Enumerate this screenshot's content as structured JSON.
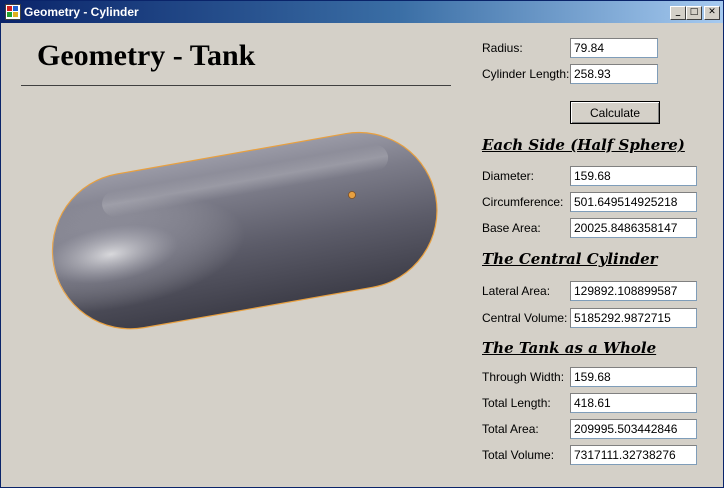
{
  "window": {
    "title": "Geometry - Cylinder",
    "minimize_label": "_",
    "maximize_label": "□",
    "close_label": "✕"
  },
  "heading": "Geometry - Tank",
  "inputs": {
    "radius_label": "Radius:",
    "radius_value": "79.84",
    "length_label": "Cylinder Length:",
    "length_value": "258.93"
  },
  "calculate_label": "Calculate",
  "half_sphere": {
    "title": "Each Side (Half Sphere)",
    "diameter_label": "Diameter:",
    "diameter_value": "159.68",
    "circumference_label": "Circumference:",
    "circumference_value": "501.649514925218",
    "base_area_label": "Base Area:",
    "base_area_value": "20025.8486358147"
  },
  "central_cylinder": {
    "title": "The Central Cylinder",
    "lateral_area_label": "Lateral Area:",
    "lateral_area_value": "129892.108899587",
    "central_volume_label": "Central Volume:",
    "central_volume_value": "5185292.9872715"
  },
  "tank_whole": {
    "title": "The Tank as a Whole",
    "through_width_label": "Through Width:",
    "through_width_value": "159.68",
    "total_length_label": "Total Length:",
    "total_length_value": "418.61",
    "total_area_label": "Total Area:",
    "total_area_value": "209995.503442846",
    "total_volume_label": "Total Volume:",
    "total_volume_value": "7317111.32738276"
  },
  "colors": {
    "titlebar_start": "#0a246a",
    "titlebar_end": "#a6caf0",
    "window_bg": "#d4d0c8",
    "capsule_body": "#5e5e6c",
    "capsule_outline": "#e8a040"
  }
}
